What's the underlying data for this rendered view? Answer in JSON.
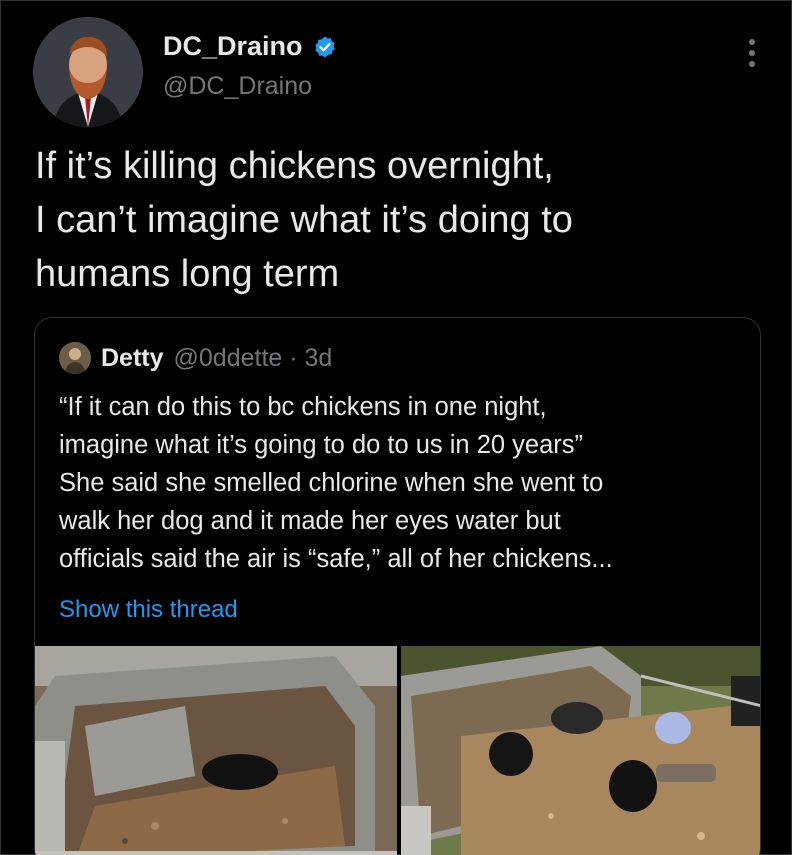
{
  "tweet": {
    "author": {
      "name": "DC_Draino",
      "handle": "@DC_Draino"
    },
    "text": "If it’s killing chickens overnight,\nI can’t imagine what it’s doing to\nhumans long term"
  },
  "quoted": {
    "author": {
      "name": "Detty",
      "handle": "@0ddette · 3d"
    },
    "text": "“If it can do this to bc chickens in one night,\nimagine what it’s going to do to us in 20 years”\nShe said she smelled chlorine when she went to\nwalk her dog and it made her eyes water but\nofficials said the air is “safe,” all of her chickens...",
    "show_thread": "Show this thread"
  },
  "colors": {
    "background": "#000000",
    "text": "#e7e9ea",
    "muted": "#71767b",
    "link": "#1d9bf0",
    "border": "#2f3336"
  },
  "icons": {
    "verified": "verified-badge-icon",
    "more": "more-options-icon"
  }
}
